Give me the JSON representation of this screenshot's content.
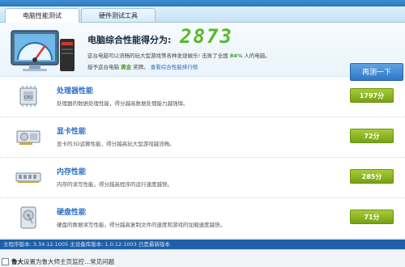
{
  "tabs": [
    {
      "label": "电脑性能测试"
    },
    {
      "label": "硬件测试工具"
    }
  ],
  "hero": {
    "score_label": "电脑综合性能得分为:",
    "score_value": "2873",
    "desc_line1_prefix": "这台电脑可以流畅的玩大型游戏等各种发烧娱乐! 击败了全国",
    "desc_line1_pct": "84%",
    "desc_line1_suffix": "人的电脑。",
    "desc_line2_prefix": "授予这台电脑",
    "desc_line2_award": "黄金",
    "desc_line2_mid": "奖牌。",
    "desc_line2_link": "查看综合性能排行榜",
    "retest_label": "再测一下"
  },
  "rows": [
    {
      "title": "处理器性能",
      "desc": "处理器的数据处理性能，得分越高数据处理能力越强悍。",
      "score": "1797分",
      "icon": "cpu-icon"
    },
    {
      "title": "显卡性能",
      "desc": "显卡的3D运算性能，得分越高玩大型游戏越流畅。",
      "score": "72分",
      "icon": "graphics-card-icon"
    },
    {
      "title": "内存性能",
      "desc": "内存的读写性能，得分越高程序的运行速度越快。",
      "score": "285分",
      "icon": "memory-icon"
    },
    {
      "title": "硬盘性能",
      "desc": "硬盘的数据读写性能，得分越高复制文件的速度和游戏的加载速度越快。",
      "score": "71分",
      "icon": "hard-disk-icon"
    }
  ],
  "status": {
    "text": "主程序版本: 3.34.12.1005   主设备库版本: 1.0.12.1003   已是最新版本"
  },
  "bottom": {
    "bold": "鲁大",
    "text": "设置为鲁大师主页监控...常见问题"
  },
  "colors": {
    "accent": "#2b6fc1",
    "score_green": "#57b82a",
    "badge_green": "#8ab526",
    "status_blue": "#1f5fa8"
  }
}
